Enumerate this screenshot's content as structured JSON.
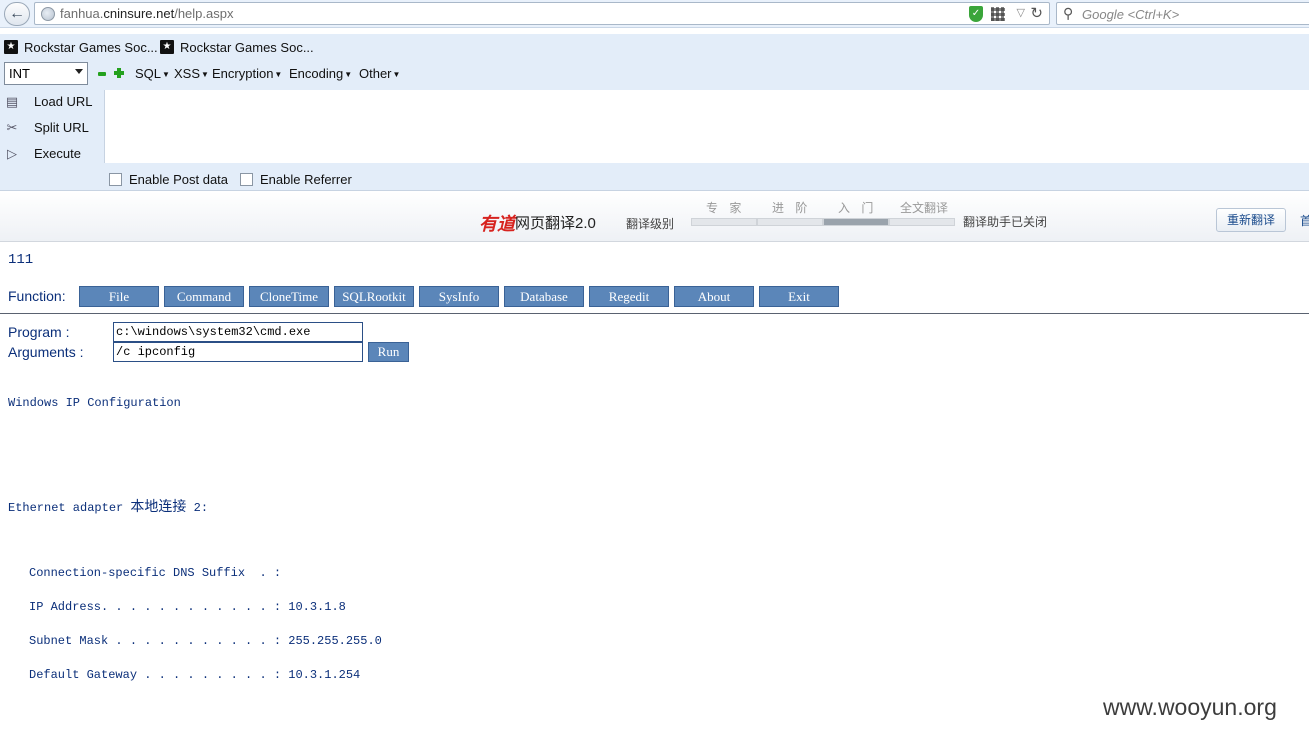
{
  "browser": {
    "url_prefix": "fanhua.",
    "url_host": "cninsure.net",
    "url_path": "/help.aspx",
    "search_placeholder": "Google <Ctrl+K>",
    "icons": [
      "back-arrow-icon",
      "globe-icon",
      "shield-icon",
      "qr-code-icon",
      "dropdown-icon",
      "reload-icon",
      "search-icon"
    ]
  },
  "bookmarks": [
    {
      "label": "Rockstar Games Soc..."
    },
    {
      "label": "Rockstar Games Soc..."
    }
  ],
  "hackbar": {
    "type_select": "INT",
    "menus": [
      "SQL",
      "XSS",
      "Encryption",
      "Encoding",
      "Other"
    ],
    "actions": [
      "Load URL",
      "Split URL",
      "Execute"
    ],
    "checkboxes": [
      "Enable Post data",
      "Enable Referrer"
    ],
    "url_value": ""
  },
  "youdao": {
    "logo": "有道",
    "title": "网页翻译2.0",
    "level_label": "翻译级别",
    "levels": [
      "专 家",
      "进 阶",
      "入 门",
      "全文翻译"
    ],
    "status": "翻译助手已关闭",
    "retranslate_button": "重新翻译",
    "extra": "首"
  },
  "page": {
    "title": "111",
    "function_label": "Function:",
    "function_buttons": [
      "File",
      "Command",
      "CloneTime",
      "SQLRootkit",
      "SysInfo",
      "Database",
      "Regedit",
      "About",
      "Exit"
    ],
    "program_label": "Program :",
    "program_value": "c:\\windows\\system32\\cmd.exe",
    "arguments_label": "Arguments :",
    "arguments_value": "/c ipconfig",
    "run_button": "Run",
    "output": {
      "header": "Windows IP Configuration",
      "adapter_prefix": "Ethernet adapter ",
      "adapter_name": "本地连接",
      "adapter_suffix": " 2:",
      "lines": [
        "Connection-specific DNS Suffix  . :",
        "IP Address. . . . . . . . . . . . : 10.3.1.8",
        "Subnet Mask . . . . . . . . . . . : 255.255.255.0",
        "Default Gateway . . . . . . . . . : 10.3.1.254"
      ]
    }
  },
  "watermark": "www.wooyun.org",
  "colors": {
    "toolbar_bg": "#e3edf9",
    "button_bg": "#5b86b9",
    "text_blue": "#0b2f7a",
    "youdao_red": "#d7231f"
  }
}
